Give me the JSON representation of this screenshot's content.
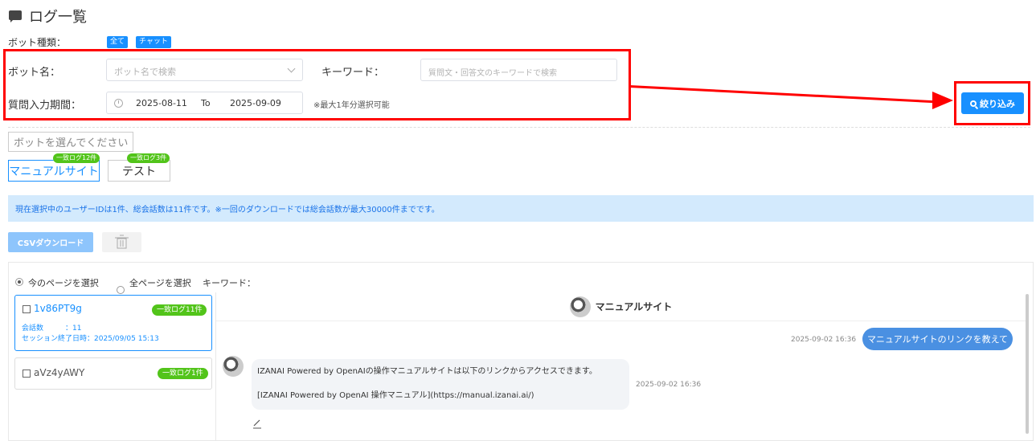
{
  "page_title": "ログ一覧",
  "filters": {
    "bot_type_label": "ボット種類：",
    "bot_type_tags": [
      "全て",
      "チャット"
    ],
    "bot_name_label": "ボット名：",
    "bot_name_placeholder": "ボット名で検索",
    "keyword_label": "キーワード：",
    "keyword_placeholder": "質問文・回答文のキーワードで検索",
    "period_label": "質問入力期間：",
    "date_from": "2025-08-11",
    "date_to_sep": "To",
    "date_to": "2025-09-09",
    "period_note": "※最大1年分選択可能",
    "search_button": "絞り込み"
  },
  "bot_select": {
    "hint": "ボットを選んでください",
    "tabs": [
      {
        "label": "マニュアルサイト",
        "badge": "一致ログ12件"
      },
      {
        "label": "テスト",
        "badge": "一致ログ3件"
      }
    ]
  },
  "info_text": "現在選択中のユーザーIDは1件、総会話数は11件です。※一回のダウンロードでは総会話数が最大30000件までです。",
  "toolbar": {
    "csv_label": "CSVダウンロード"
  },
  "selection": {
    "current_page": "今のページを選択",
    "all_pages": "全ページを選択",
    "keyword_label": "キーワード："
  },
  "users": [
    {
      "id": "1v86PT9g",
      "badge": "一致ログ11件",
      "meta1": "会話数　　　：11",
      "meta2": "セッション終了日時：2025/09/05 15:13"
    },
    {
      "id": "aVz4yAWY",
      "badge": "一致ログ1件"
    }
  ],
  "chat": {
    "title": "マニュアルサイト",
    "user_msg_time": "2025-09-02 16:36",
    "user_msg": "マニュアルサイトのリンクを教えて",
    "bot_msg_line1": "IZANAI Powered by OpenAIの操作マニュアルサイトは以下のリンクからアクセスできます。",
    "bot_msg_line2": "[IZANAI Powered by OpenAI 操作マニュアル](https://manual.izanai.ai/)",
    "bot_msg_time": "2025-09-02 16:36"
  },
  "colors": {
    "primary": "#1890ff",
    "annotation": "#ff0000",
    "badge_green": "#52c41a"
  }
}
